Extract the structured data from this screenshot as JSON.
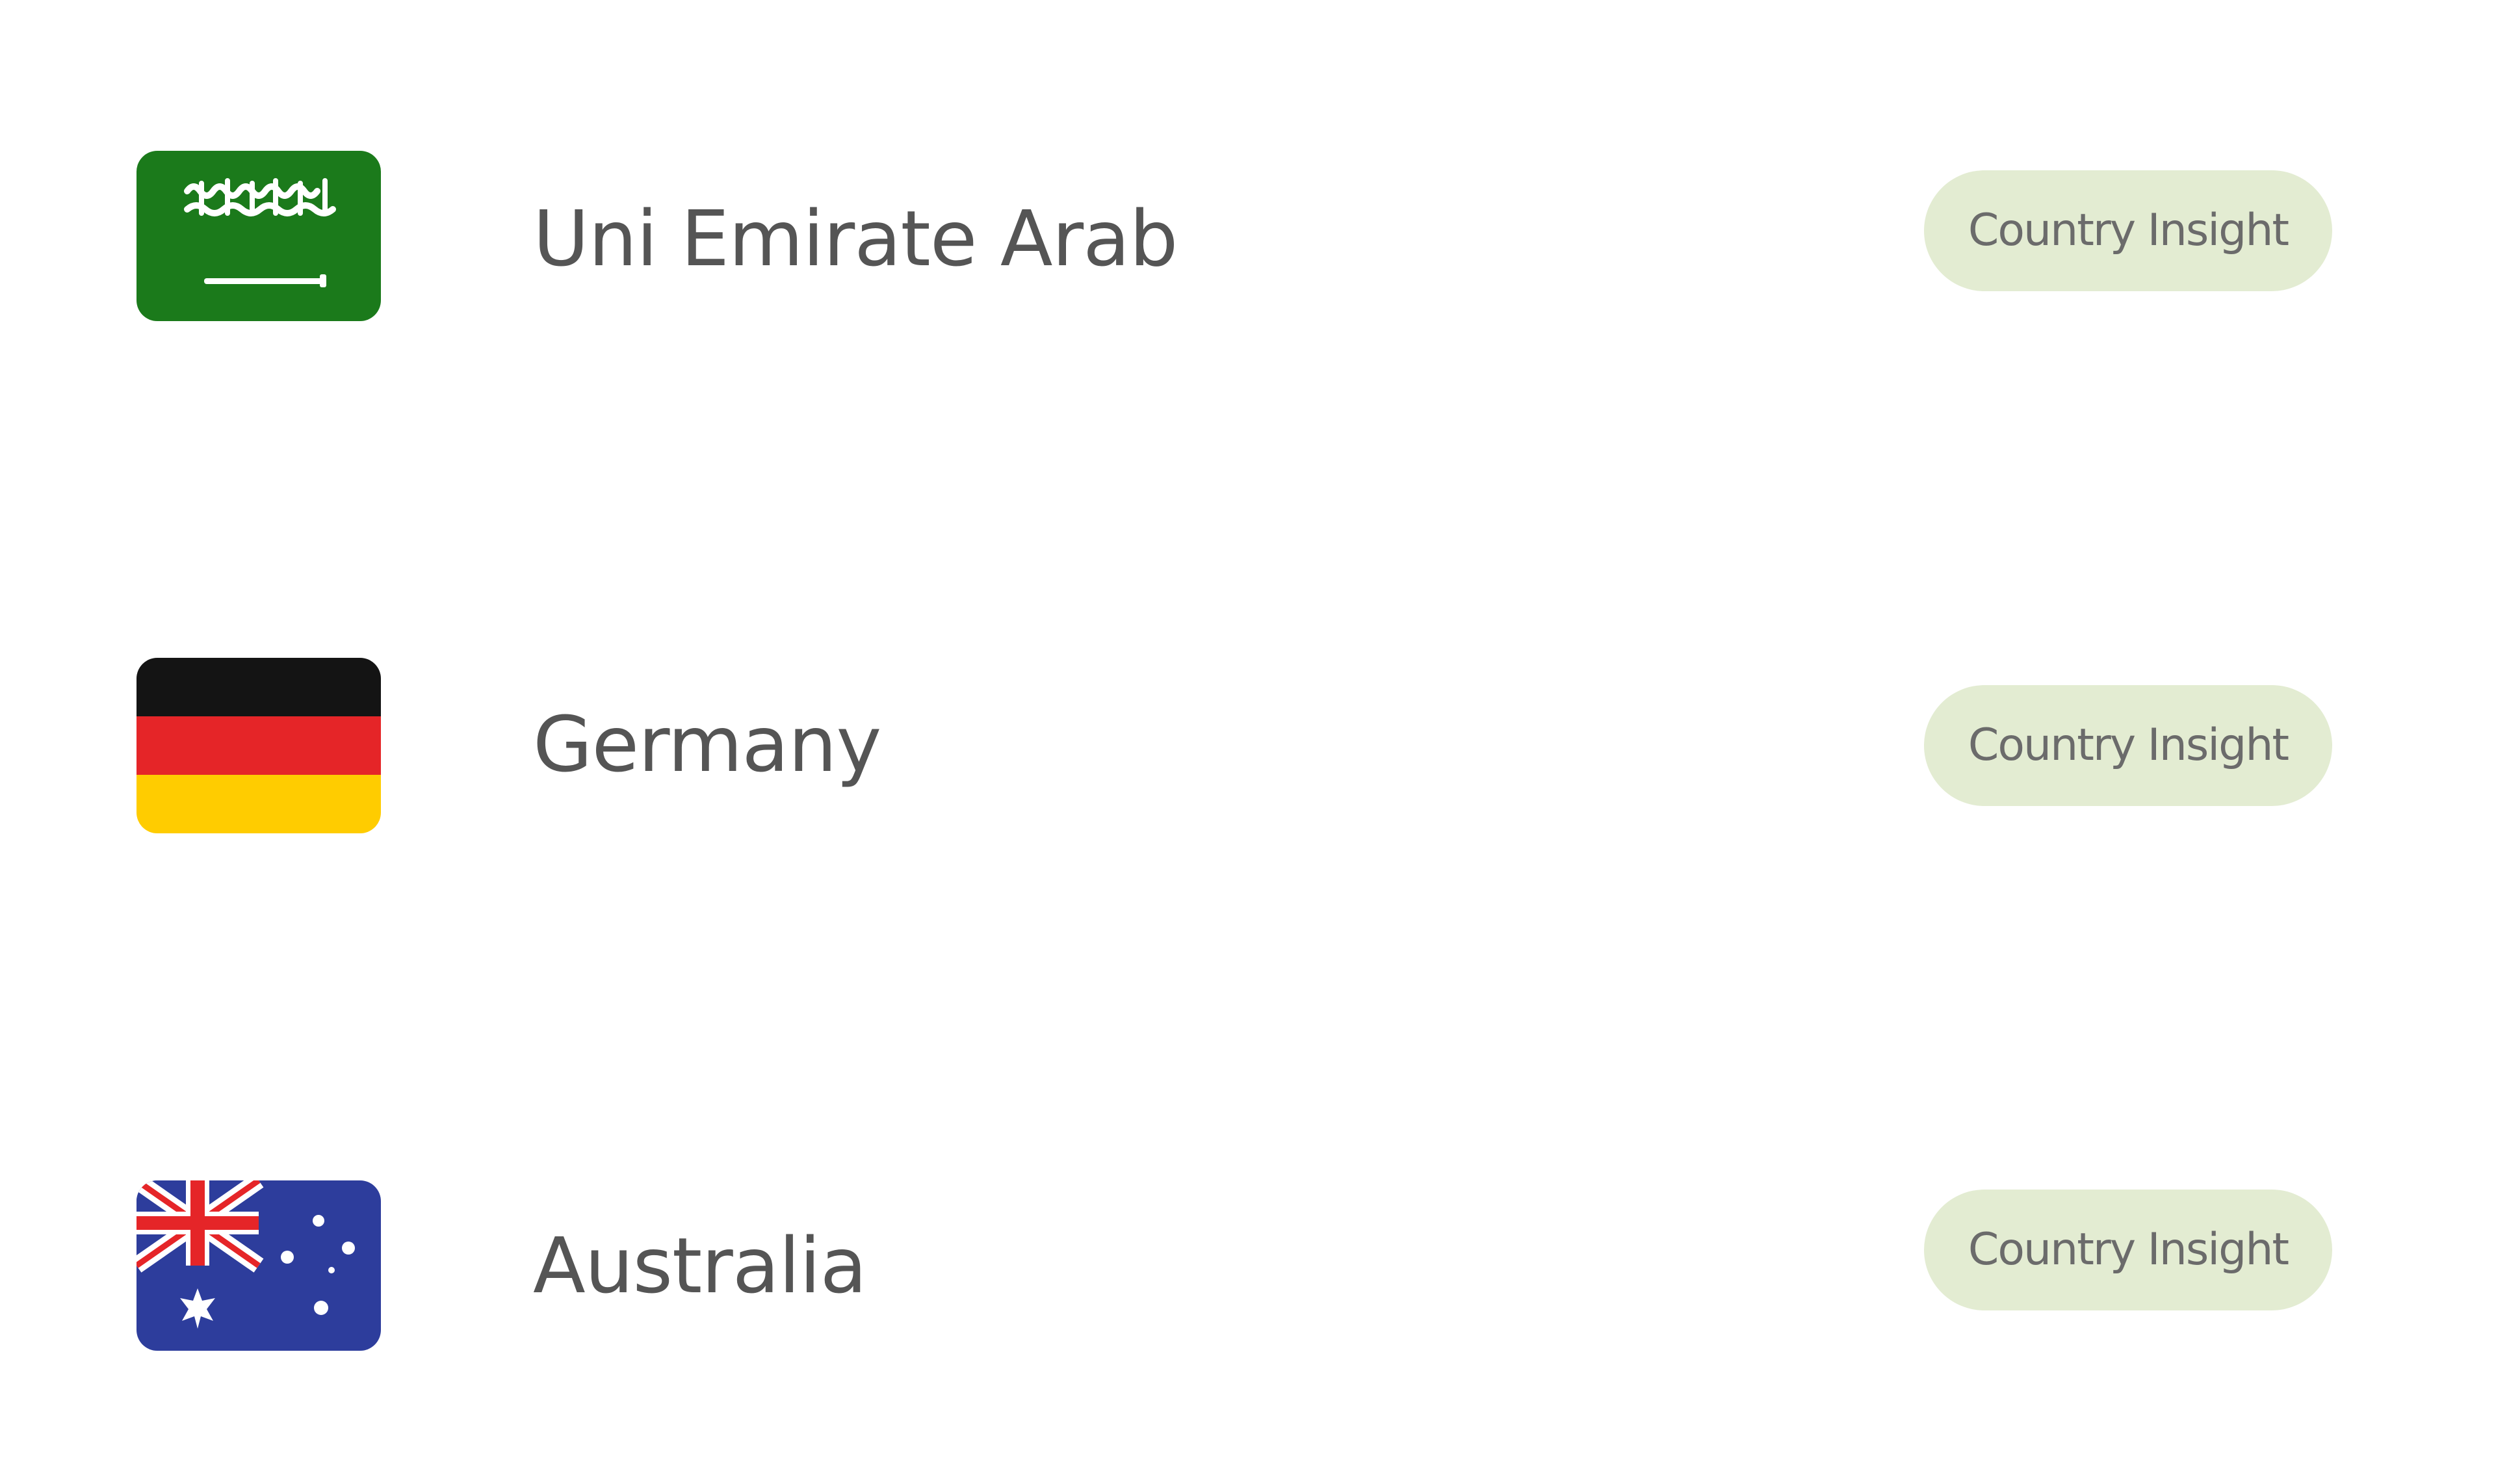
{
  "countries": [
    {
      "name": "Uni Emirate Arab",
      "flag_icon": "saudi-arabia-flag-icon",
      "button_label": "Country Insight"
    },
    {
      "name": "Germany",
      "flag_icon": "germany-flag-icon",
      "button_label": "Country Insight"
    },
    {
      "name": "Australia",
      "flag_icon": "australia-flag-icon",
      "button_label": "Country Insight"
    }
  ],
  "colors": {
    "button_background": "#e3ecd2",
    "button_text": "#6b6b6b",
    "country_text": "#555555",
    "saudi_green": "#1b7a1b",
    "germany_black": "#141414",
    "germany_red": "#e52528",
    "germany_gold": "#ffcc00",
    "australia_blue": "#2d3d9c"
  }
}
